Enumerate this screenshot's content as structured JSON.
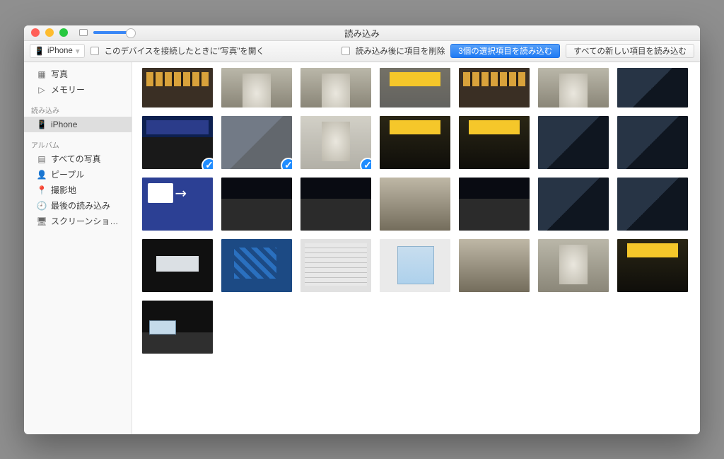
{
  "window": {
    "title": "読み込み"
  },
  "toolbar": {
    "device_name": "iPhone",
    "open_photos_label": "このデバイスを接続したときに\"写真\"を開く",
    "delete_after_label": "読み込み後に項目を削除",
    "import_selected_label": "3個の選択項目を読み込む",
    "import_all_label": "すべての新しい項目を読み込む"
  },
  "sidebar": {
    "photos_label": "写真",
    "memories_label": "メモリー",
    "import_header": "読み込み",
    "import_device_label": "iPhone",
    "albums_header": "アルバム",
    "all_photos_label": "すべての写真",
    "people_label": "ピープル",
    "places_label": "撮影地",
    "recent_import_label": "最後の読み込み",
    "screenshots_label": "スクリーンショ…"
  },
  "grid": {
    "selected_indices": [
      7,
      8,
      9
    ],
    "items": [
      {
        "style": "p-store half"
      },
      {
        "style": "p-hall half"
      },
      {
        "style": "p-hall half"
      },
      {
        "style": "p-signY half faded"
      },
      {
        "style": "p-store half"
      },
      {
        "style": "p-hall half"
      },
      {
        "style": "p-esc half"
      },
      {
        "style": "p-station"
      },
      {
        "style": "p-esc faded"
      },
      {
        "style": "p-hall faded"
      },
      {
        "style": "p-signY"
      },
      {
        "style": "p-signY"
      },
      {
        "style": "p-esc"
      },
      {
        "style": "p-esc"
      },
      {
        "style": "p-rinkai"
      },
      {
        "style": "p-night"
      },
      {
        "style": "p-night"
      },
      {
        "style": "p-gate"
      },
      {
        "style": "p-night"
      },
      {
        "style": "p-esc"
      },
      {
        "style": "p-esc"
      },
      {
        "style": "p-sign2"
      },
      {
        "style": "p-bluewall"
      },
      {
        "style": "p-board"
      },
      {
        "style": "p-map"
      },
      {
        "style": "p-gate"
      },
      {
        "style": "p-hall"
      },
      {
        "style": "p-signY"
      },
      {
        "style": "p-platform"
      }
    ]
  }
}
